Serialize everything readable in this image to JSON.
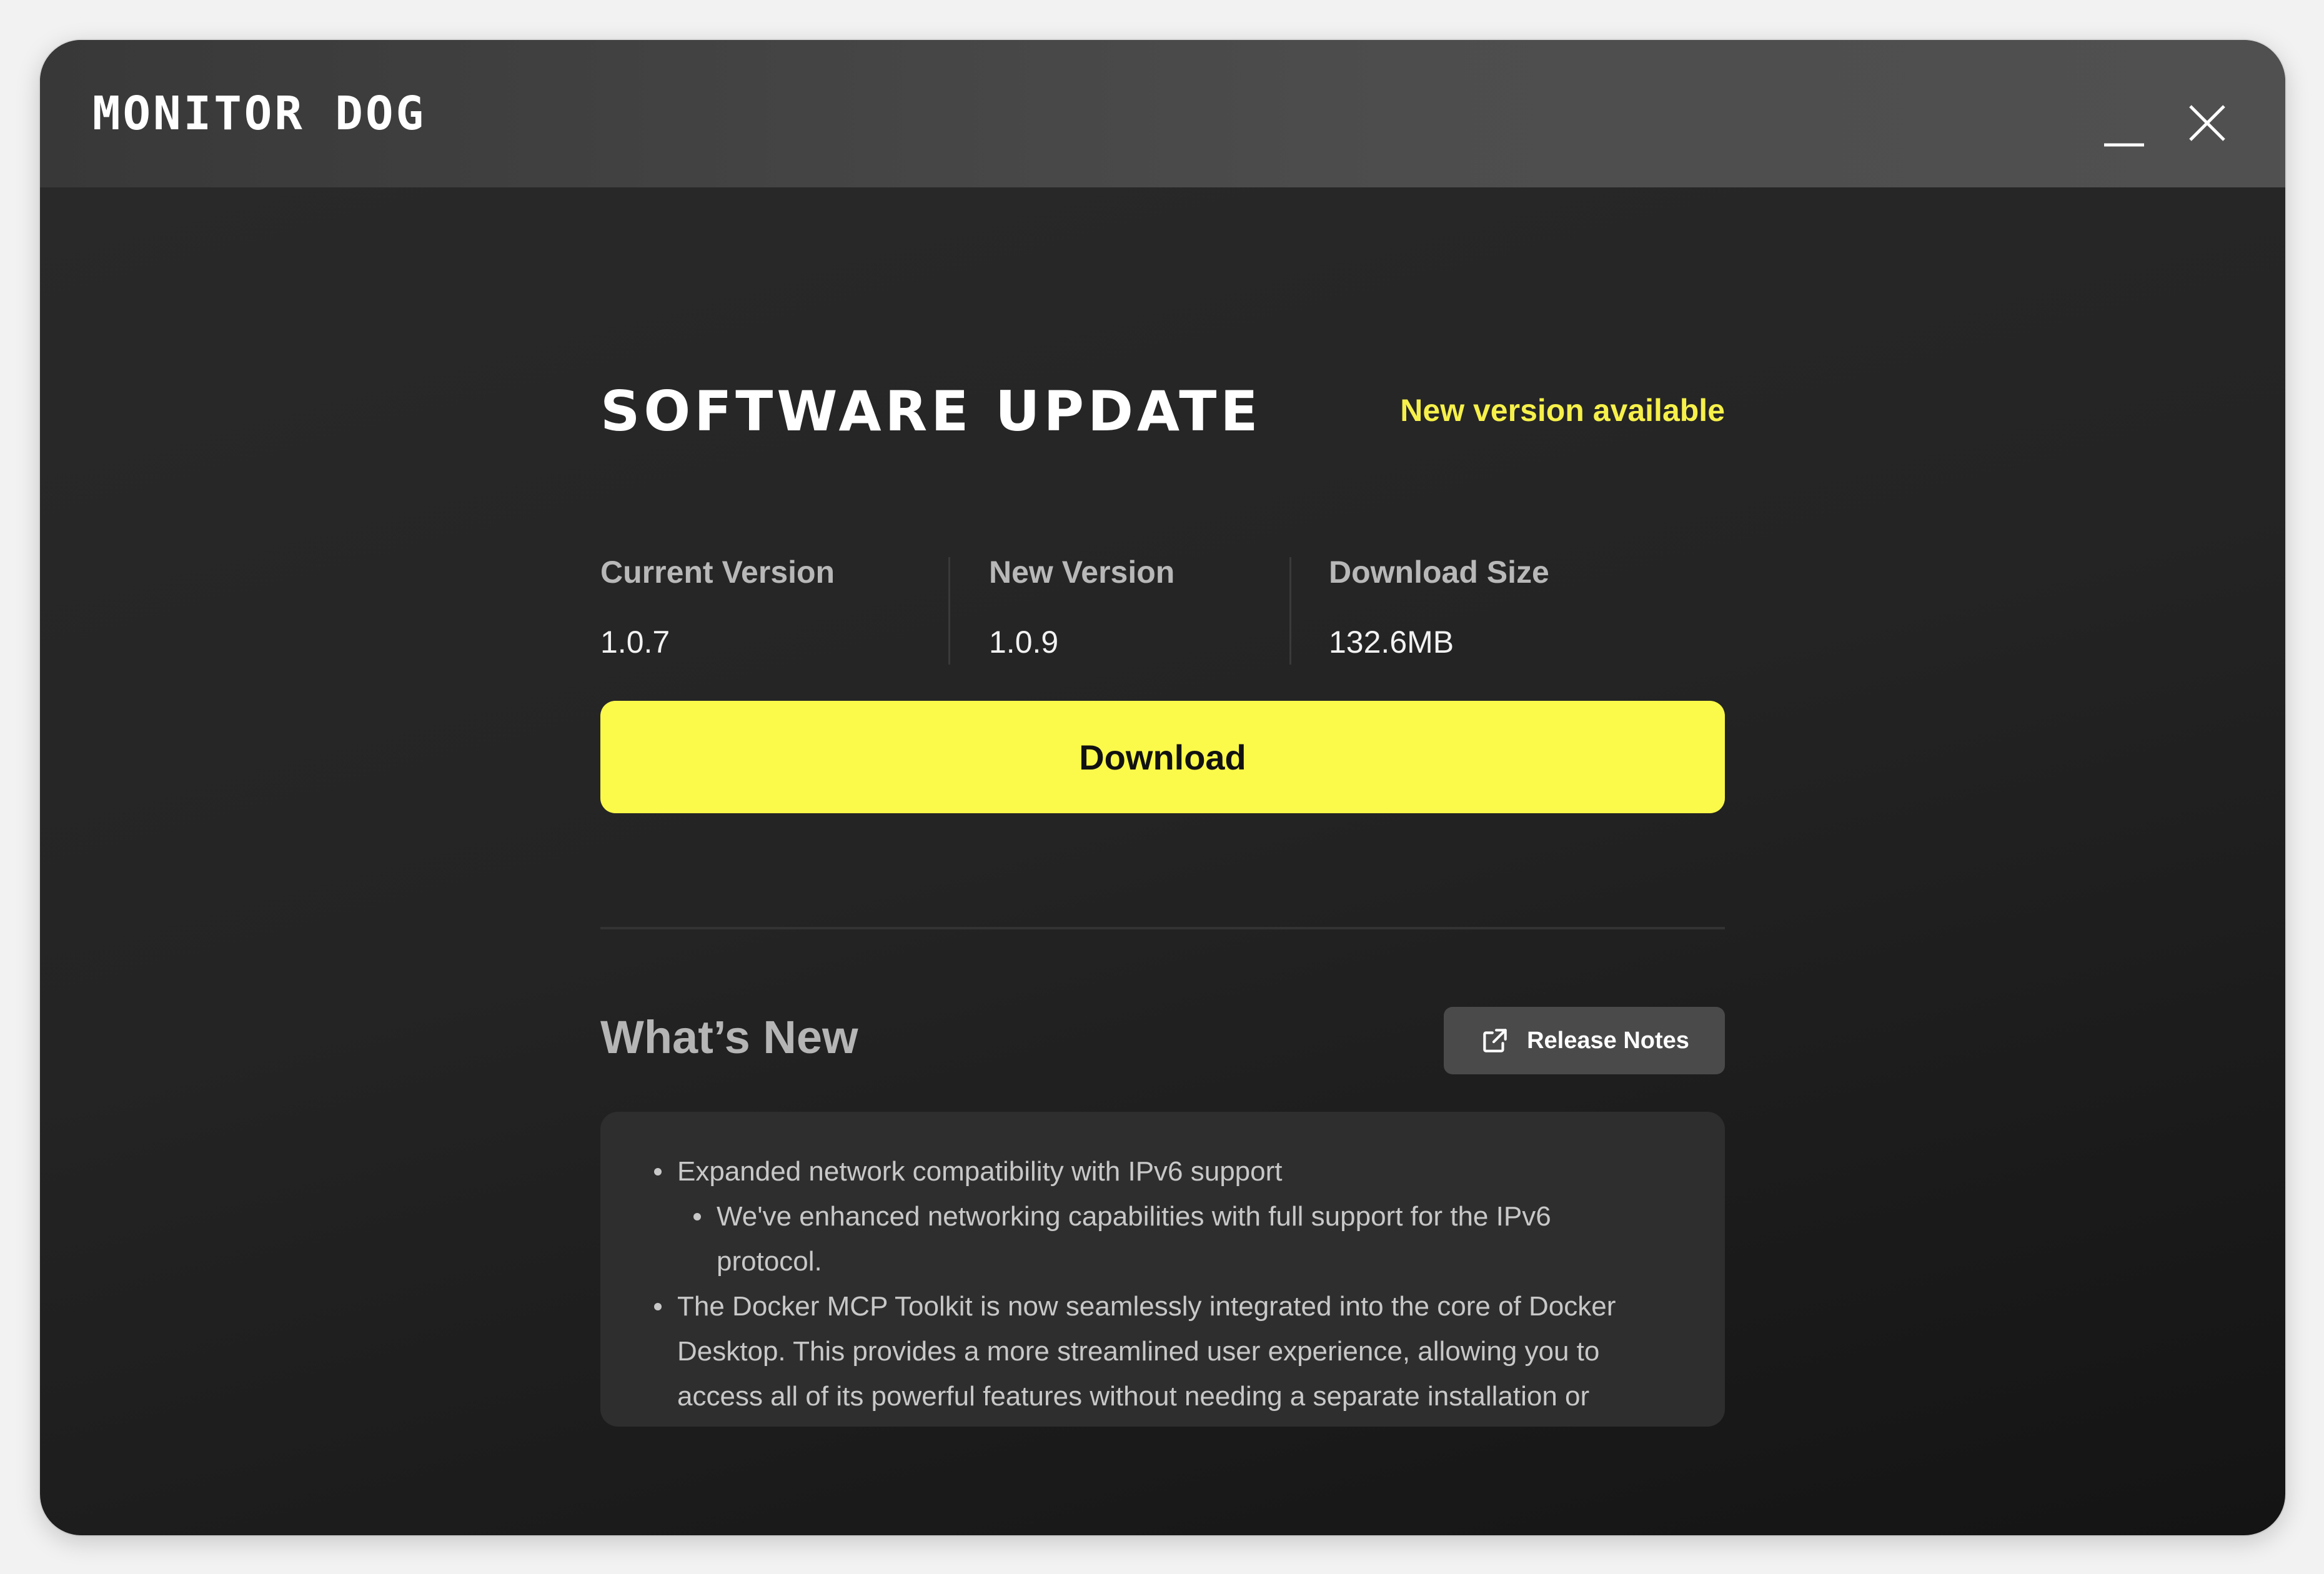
{
  "app": {
    "logo_text": "MONITOR DOG"
  },
  "window_controls": {
    "minimize_icon": "minimize-icon",
    "close_icon": "close-icon"
  },
  "page": {
    "title": "SOFTWARE UPDATE",
    "status": "New version available"
  },
  "stats": [
    {
      "label": "Current Version",
      "value": "1.0.7"
    },
    {
      "label": "New Version",
      "value": "1.0.9"
    },
    {
      "label": "Download Size",
      "value": "132.6MB"
    }
  ],
  "actions": {
    "download_label": "Download",
    "release_notes_label": "Release Notes",
    "release_notes_icon": "external-link-icon"
  },
  "whats_new": {
    "title": "What’s New",
    "lines": [
      {
        "text": "Expanded network compatibility with IPv6 support",
        "bullet": true,
        "level": 1
      },
      {
        "text": "We've enhanced networking capabilities with full support for the IPv6",
        "bullet": true,
        "level": 2
      },
      {
        "text": "protocol.",
        "bullet": false,
        "level": 2
      },
      {
        "text": "The Docker MCP Toolkit is now seamlessly integrated into the core of Docker",
        "bullet": true,
        "level": 1
      },
      {
        "text": "Desktop. This provides a more streamlined user experience, allowing you to",
        "bullet": false,
        "level": 1
      },
      {
        "text": "access all of its powerful features without needing a separate installation or",
        "bullet": false,
        "level": 1
      }
    ]
  },
  "colors": {
    "accent": "#fbf94a",
    "status_text": "#f6f04a",
    "background": "#242424",
    "titlebar": "#4d4d4d"
  }
}
